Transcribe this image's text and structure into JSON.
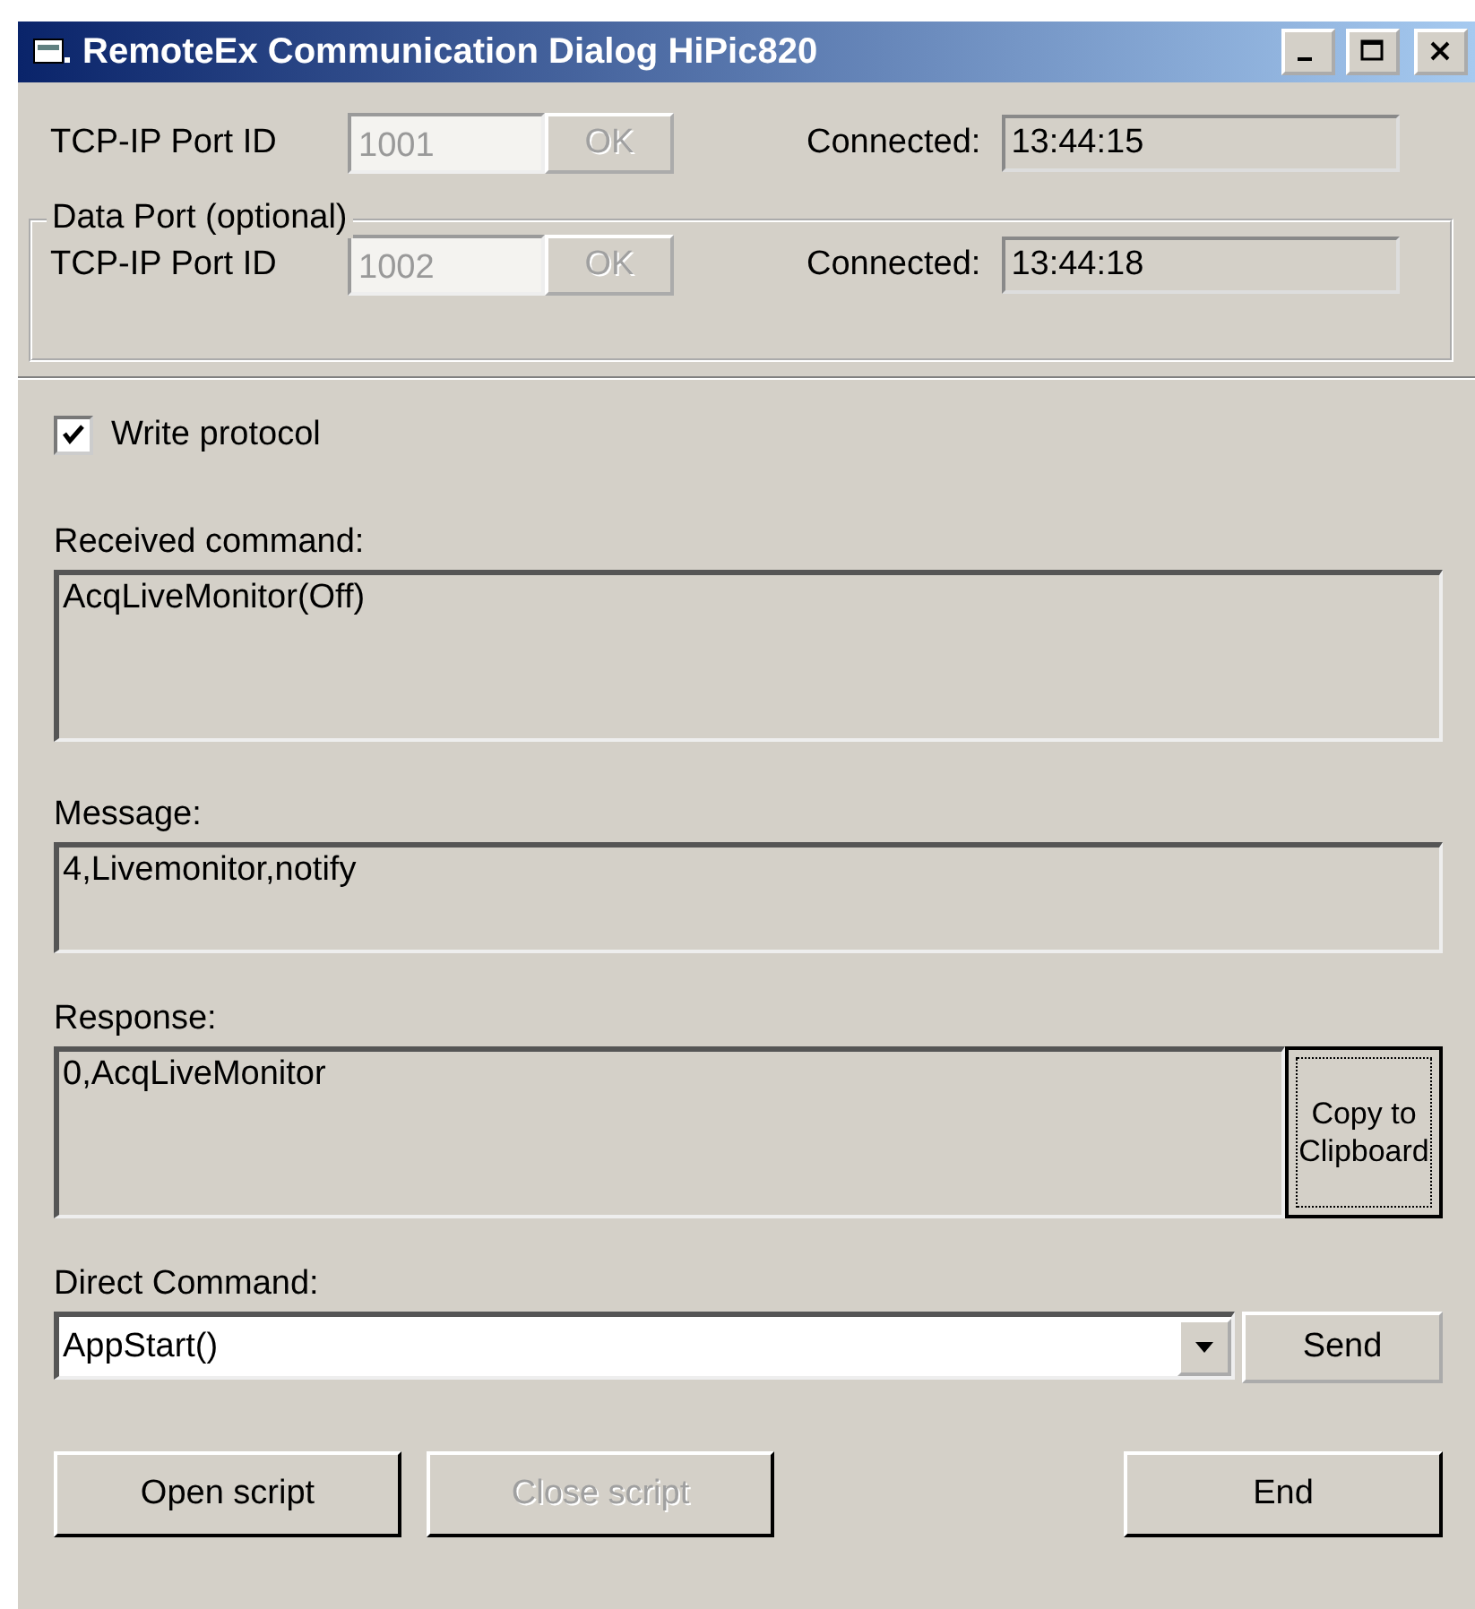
{
  "window": {
    "title": "RemoteEx Communication Dialog HiPic820"
  },
  "command_port": {
    "label": "TCP-IP Port ID",
    "port": "1001",
    "port_disabled": true,
    "ok": "OK",
    "ok_disabled": true,
    "connected_label": "Connected:",
    "connected": "13:44:15"
  },
  "data_port": {
    "group_title": "Data Port (optional)",
    "label": "TCP-IP Port ID",
    "port": "1002",
    "port_disabled": true,
    "ok": "OK",
    "ok_disabled": true,
    "connected_label": "Connected:",
    "connected": "13:44:18"
  },
  "write_protocol": {
    "label": "Write protocol",
    "checked": true
  },
  "received_command": {
    "label": "Received command:",
    "value": "AcqLiveMonitor(Off)"
  },
  "message": {
    "label": "Message:",
    "value": "4,Livemonitor,notify"
  },
  "response": {
    "label": "Response:",
    "value": "0,AcqLiveMonitor",
    "copy_button": "Copy to Clipboard"
  },
  "direct_command": {
    "label": "Direct Command:",
    "value": "AppStart()",
    "send_button": "Send"
  },
  "buttons": [
    {
      "label": "Open script",
      "disabled": false
    },
    {
      "label": "Close script",
      "disabled": true
    },
    {
      "label": "End",
      "disabled": false
    }
  ]
}
